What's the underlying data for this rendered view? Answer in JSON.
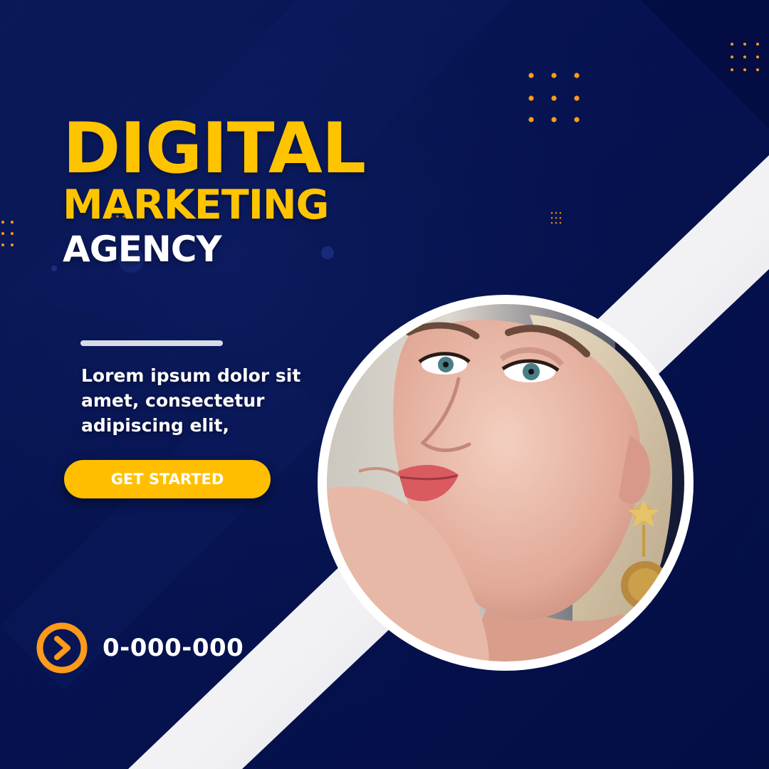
{
  "headline": {
    "line1": "DIGITAL",
    "line2": "MARKETING",
    "line3": "AGENCY"
  },
  "body_text": "Lorem ipsum dolor sit amet, consectetur adipiscing elit,",
  "cta": {
    "label": "GET STARTED"
  },
  "contact": {
    "phone": "0-000-000",
    "icon": "play-circle-icon"
  },
  "colors": {
    "background": "#061352",
    "accent_yellow": "#ffc400",
    "accent_orange": "#ff9a1a",
    "text_white": "#ffffff"
  }
}
